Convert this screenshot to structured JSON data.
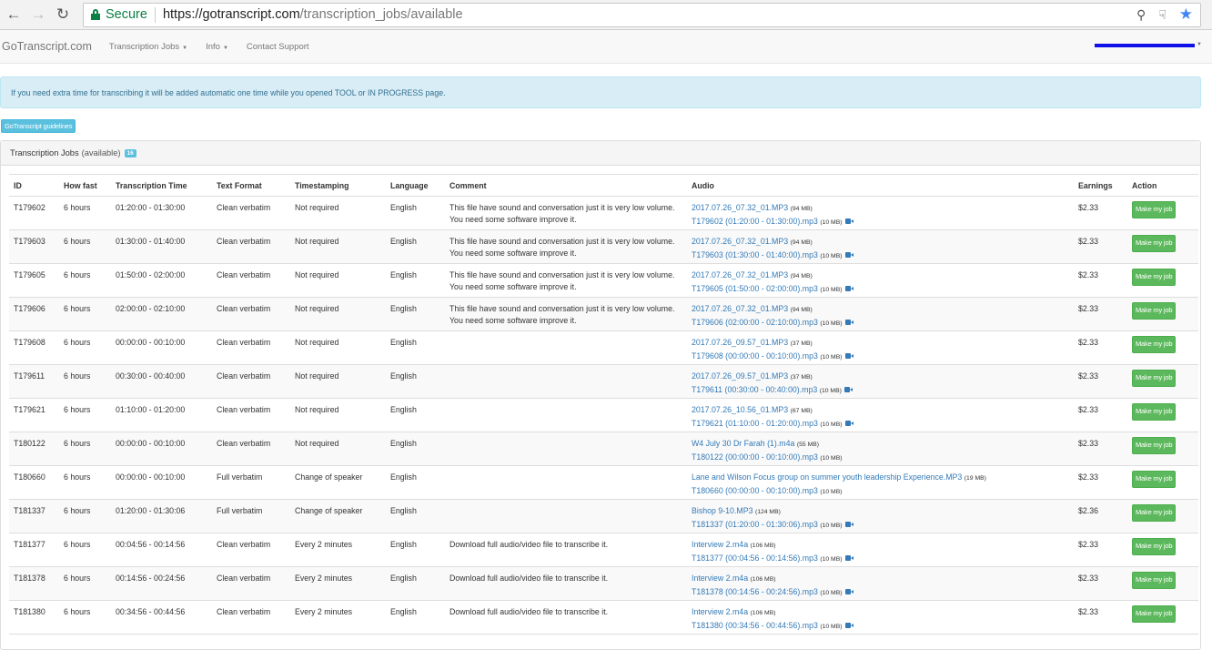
{
  "browser": {
    "secure_label": "Secure",
    "url_host": "https://gotranscript.com",
    "url_path": "/transcription_jobs/available"
  },
  "navbar": {
    "brand": "GoTranscript.com",
    "items": [
      {
        "label": "Transcription Jobs",
        "dropdown": true
      },
      {
        "label": "Info",
        "dropdown": true
      },
      {
        "label": "Contact Support",
        "dropdown": false
      }
    ]
  },
  "alert": {
    "text": "If you need extra time for transcribing it will be added automatic one time while you opened TOOL or IN PROGRESS page."
  },
  "guidelines_button": "GoTranscript guidelines",
  "panel": {
    "title": "Transcription Jobs",
    "subtitle": "(available)",
    "badge_count": "16"
  },
  "table": {
    "headers": [
      "ID",
      "How fast",
      "Transcription Time",
      "Text Format",
      "Timestamping",
      "Language",
      "Comment",
      "Audio",
      "Earnings",
      "Action"
    ],
    "action_label": "Make my job",
    "rows": [
      {
        "id": "T179602",
        "how_fast": "6 hours",
        "time": "01:20:00 - 01:30:00",
        "format": "Clean verbatim",
        "timestamping": "Not required",
        "language": "English",
        "comment": "This file have sound and conversation just it is very low volume. You need some software improve it.",
        "audio_main": "2017.07.26_07.32_01.MP3",
        "audio_main_size": "(94 MB)",
        "audio_part": "T179602 (01:20:00 - 01:30:00).mp3",
        "audio_part_size": "(10 MB)",
        "video": true,
        "earnings": "$2.33"
      },
      {
        "id": "T179603",
        "how_fast": "6 hours",
        "time": "01:30:00 - 01:40:00",
        "format": "Clean verbatim",
        "timestamping": "Not required",
        "language": "English",
        "comment": "This file have sound and conversation just it is very low volume. You need some software improve it.",
        "audio_main": "2017.07.26_07.32_01.MP3",
        "audio_main_size": "(94 MB)",
        "audio_part": "T179603 (01:30:00 - 01:40:00).mp3",
        "audio_part_size": "(10 MB)",
        "video": true,
        "earnings": "$2.33"
      },
      {
        "id": "T179605",
        "how_fast": "6 hours",
        "time": "01:50:00 - 02:00:00",
        "format": "Clean verbatim",
        "timestamping": "Not required",
        "language": "English",
        "comment": "This file have sound and conversation just it is very low volume. You need some software improve it.",
        "audio_main": "2017.07.26_07.32_01.MP3",
        "audio_main_size": "(94 MB)",
        "audio_part": "T179605 (01:50:00 - 02:00:00).mp3",
        "audio_part_size": "(10 MB)",
        "video": true,
        "earnings": "$2.33"
      },
      {
        "id": "T179606",
        "how_fast": "6 hours",
        "time": "02:00:00 - 02:10:00",
        "format": "Clean verbatim",
        "timestamping": "Not required",
        "language": "English",
        "comment": "This file have sound and conversation just it is very low volume. You need some software improve it.",
        "audio_main": "2017.07.26_07.32_01.MP3",
        "audio_main_size": "(94 MB)",
        "audio_part": "T179606 (02:00:00 - 02:10:00).mp3",
        "audio_part_size": "(10 MB)",
        "video": true,
        "earnings": "$2.33"
      },
      {
        "id": "T179608",
        "how_fast": "6 hours",
        "time": "00:00:00 - 00:10:00",
        "format": "Clean verbatim",
        "timestamping": "Not required",
        "language": "English",
        "comment": "",
        "audio_main": "2017.07.26_09.57_01.MP3",
        "audio_main_size": "(37 MB)",
        "audio_part": "T179608 (00:00:00 - 00:10:00).mp3",
        "audio_part_size": "(10 MB)",
        "video": true,
        "earnings": "$2.33"
      },
      {
        "id": "T179611",
        "how_fast": "6 hours",
        "time": "00:30:00 - 00:40:00",
        "format": "Clean verbatim",
        "timestamping": "Not required",
        "language": "English",
        "comment": "",
        "audio_main": "2017.07.26_09.57_01.MP3",
        "audio_main_size": "(37 MB)",
        "audio_part": "T179611 (00:30:00 - 00:40:00).mp3",
        "audio_part_size": "(10 MB)",
        "video": true,
        "earnings": "$2.33"
      },
      {
        "id": "T179621",
        "how_fast": "6 hours",
        "time": "01:10:00 - 01:20:00",
        "format": "Clean verbatim",
        "timestamping": "Not required",
        "language": "English",
        "comment": "",
        "audio_main": "2017.07.26_10.56_01.MP3",
        "audio_main_size": "(67 MB)",
        "audio_part": "T179621 (01:10:00 - 01:20:00).mp3",
        "audio_part_size": "(10 MB)",
        "video": true,
        "earnings": "$2.33"
      },
      {
        "id": "T180122",
        "how_fast": "6 hours",
        "time": "00:00:00 - 00:10:00",
        "format": "Clean verbatim",
        "timestamping": "Not required",
        "language": "English",
        "comment": "",
        "audio_main": "W4 July 30 Dr Farah (1).m4a",
        "audio_main_size": "(55 MB)",
        "audio_part": "T180122 (00:00:00 - 00:10:00).mp3",
        "audio_part_size": "(10 MB)",
        "video": false,
        "earnings": "$2.33"
      },
      {
        "id": "T180660",
        "how_fast": "6 hours",
        "time": "00:00:00 - 00:10:00",
        "format": "Full verbatim",
        "timestamping": "Change of speaker",
        "language": "English",
        "comment": "",
        "audio_main": "Lane and Wilson Focus group on summer youth leadership Experience.MP3",
        "audio_main_size": "(19 MB)",
        "audio_part": "T180660 (00:00:00 - 00:10:00).mp3",
        "audio_part_size": "(10 MB)",
        "video": false,
        "earnings": "$2.33"
      },
      {
        "id": "T181337",
        "how_fast": "6 hours",
        "time": "01:20:00 - 01:30:06",
        "format": "Full verbatim",
        "timestamping": "Change of speaker",
        "language": "English",
        "comment": "",
        "audio_main": "Bishop 9-10.MP3",
        "audio_main_size": "(124 MB)",
        "audio_part": "T181337 (01:20:00 - 01:30:06).mp3",
        "audio_part_size": "(10 MB)",
        "video": true,
        "earnings": "$2.36"
      },
      {
        "id": "T181377",
        "how_fast": "6 hours",
        "time": "00:04:56 - 00:14:56",
        "format": "Clean verbatim",
        "timestamping": "Every 2 minutes",
        "language": "English",
        "comment": "Download full audio/video file to transcribe it.",
        "audio_main": "Interview 2.m4a",
        "audio_main_size": "(106 MB)",
        "audio_part": "T181377 (00:04:56 - 00:14:56).mp3",
        "audio_part_size": "(10 MB)",
        "video": true,
        "earnings": "$2.33"
      },
      {
        "id": "T181378",
        "how_fast": "6 hours",
        "time": "00:14:56 - 00:24:56",
        "format": "Clean verbatim",
        "timestamping": "Every 2 minutes",
        "language": "English",
        "comment": "Download full audio/video file to transcribe it.",
        "audio_main": "Interview 2.m4a",
        "audio_main_size": "(106 MB)",
        "audio_part": "T181378 (00:14:56 - 00:24:56).mp3",
        "audio_part_size": "(10 MB)",
        "video": true,
        "earnings": "$2.33"
      },
      {
        "id": "T181380",
        "how_fast": "6 hours",
        "time": "00:34:56 - 00:44:56",
        "format": "Clean verbatim",
        "timestamping": "Every 2 minutes",
        "language": "English",
        "comment": "Download full audio/video file to transcribe it.",
        "audio_main": "Interview 2.m4a",
        "audio_main_size": "(106 MB)",
        "audio_part": "T181380 (00:34:56 - 00:44:56).mp3",
        "audio_part_size": "(10 MB)",
        "video": true,
        "earnings": "$2.33"
      }
    ]
  }
}
